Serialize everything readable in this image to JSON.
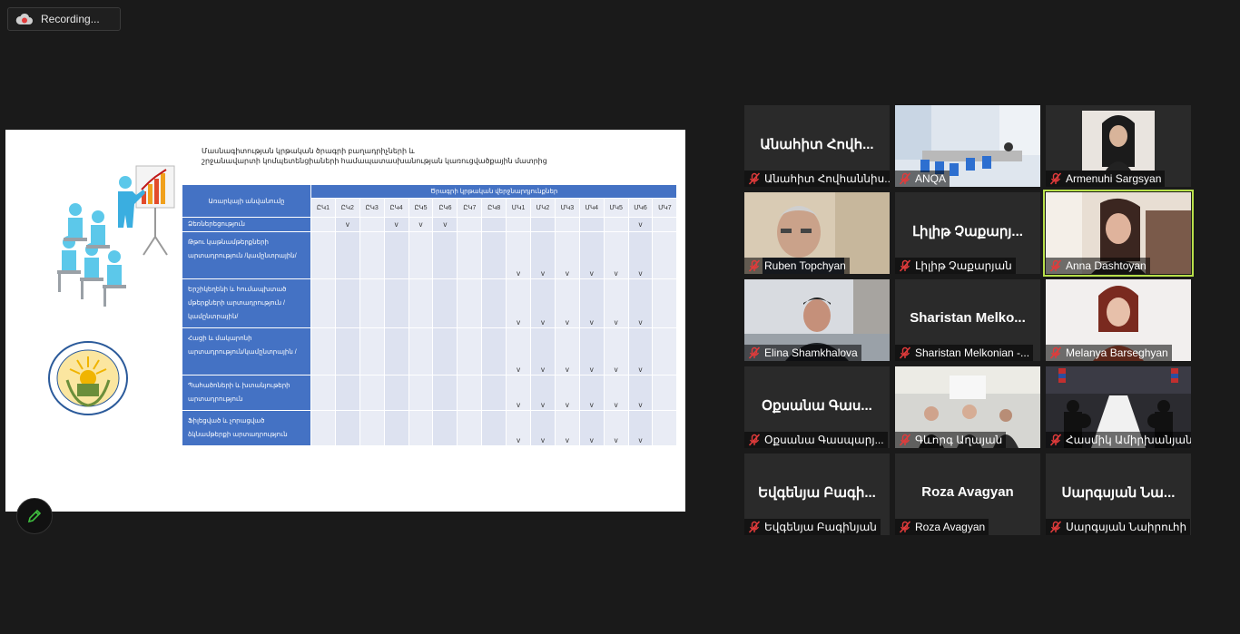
{
  "recording": {
    "label": "Recording..."
  },
  "slide": {
    "title_line1": "Մասնագիտության կրթական ծրագրի բաղադրիչների և",
    "title_line2": "շրջանավարտի կոմպետենցիաների համապատասխանության կառուցվածքային մատրից",
    "table": {
      "subject_header": "Առարկայի անվանումը",
      "outcomes_header": "Ծրագրի կրթական վերջնարդյունքներ",
      "codes": [
        "ԸԿ1",
        "ԸԿ2",
        "ԸԿ3",
        "ԸԿ4",
        "ԸԿ5",
        "ԸԿ6",
        "ԸԿ7",
        "ԸԿ8",
        "ՄԿ1",
        "ՄԿ2",
        "ՄԿ3",
        "ՄԿ4",
        "ՄԿ5",
        "ՄԿ6",
        "ՄԿ7"
      ],
      "check_mark": "v",
      "rows": [
        {
          "name": "Ձեռներեցություն",
          "checks": [
            0,
            1,
            0,
            1,
            1,
            1,
            0,
            0,
            0,
            0,
            0,
            0,
            0,
            1,
            0
          ]
        },
        {
          "name": "Թթու կաթնամթերքների արտադրություն /կամընտրային/",
          "checks": [
            0,
            0,
            0,
            0,
            0,
            0,
            0,
            0,
            1,
            1,
            1,
            1,
            1,
            1,
            0
          ]
        },
        {
          "name": "Երշիկեղենի և հումապխտած մթերքների արտադրություն /կամընտրային/",
          "checks": [
            0,
            0,
            0,
            0,
            0,
            0,
            0,
            0,
            1,
            1,
            1,
            1,
            1,
            1,
            0
          ]
        },
        {
          "name": "Հացի և մակարոնի արտադրություն/կամընտրային /",
          "checks": [
            0,
            0,
            0,
            0,
            0,
            0,
            0,
            0,
            1,
            1,
            1,
            1,
            1,
            1,
            0
          ]
        },
        {
          "name": "Պահածոների և խտանյութերի արտադրություն",
          "checks": [
            0,
            0,
            0,
            0,
            0,
            0,
            0,
            0,
            1,
            1,
            1,
            1,
            1,
            1,
            0
          ]
        },
        {
          "name": "Ֆիլեցված և չորացված ձկնամթերքի արտադրություն",
          "checks": [
            0,
            0,
            0,
            0,
            0,
            0,
            0,
            0,
            1,
            1,
            1,
            1,
            1,
            1,
            0
          ]
        }
      ]
    }
  },
  "participants": [
    {
      "big": "Անահիտ Հովհ...",
      "label": "Անահիտ Հովհաննիս...",
      "video": false
    },
    {
      "big": "",
      "label": "ANQA",
      "video": "room"
    },
    {
      "big": "",
      "label": "Armenuhi Sargsyan",
      "video": "woman-dark"
    },
    {
      "big": "",
      "label": "Ruben Topchyan",
      "video": "man-grey"
    },
    {
      "big": "Լիլիթ Չաքարյ...",
      "label": "Լիլիթ Չաքարյան",
      "video": false
    },
    {
      "big": "",
      "label": "Anna Dashtoyan",
      "video": "woman-room",
      "active": true
    },
    {
      "big": "",
      "label": "Elina Shamkhalova",
      "video": "man-room"
    },
    {
      "big": "Sharistan  Melko...",
      "label": "Sharistan Melkonian -...",
      "video": false
    },
    {
      "big": "",
      "label": "Melanya Barseghyan",
      "video": "woman-red"
    },
    {
      "big": "Օքսանա Գաս...",
      "label": "Օքսանա Գասպարյ...",
      "video": false
    },
    {
      "big": "",
      "label": "Գևորգ Աղայան",
      "video": "group"
    },
    {
      "big": "",
      "label": "Հասմիկ Ամիրխանյան",
      "video": "conference"
    },
    {
      "big": "Եվգենյա Բագի...",
      "label": "Եվգենյա Բագինյան",
      "video": false
    },
    {
      "big": "Roza Avagyan",
      "label": "Roza Avagyan",
      "video": false
    },
    {
      "big": "Սարգսյան Նա...",
      "label": "Սարգսյան Նաիրուհի",
      "video": false
    }
  ]
}
